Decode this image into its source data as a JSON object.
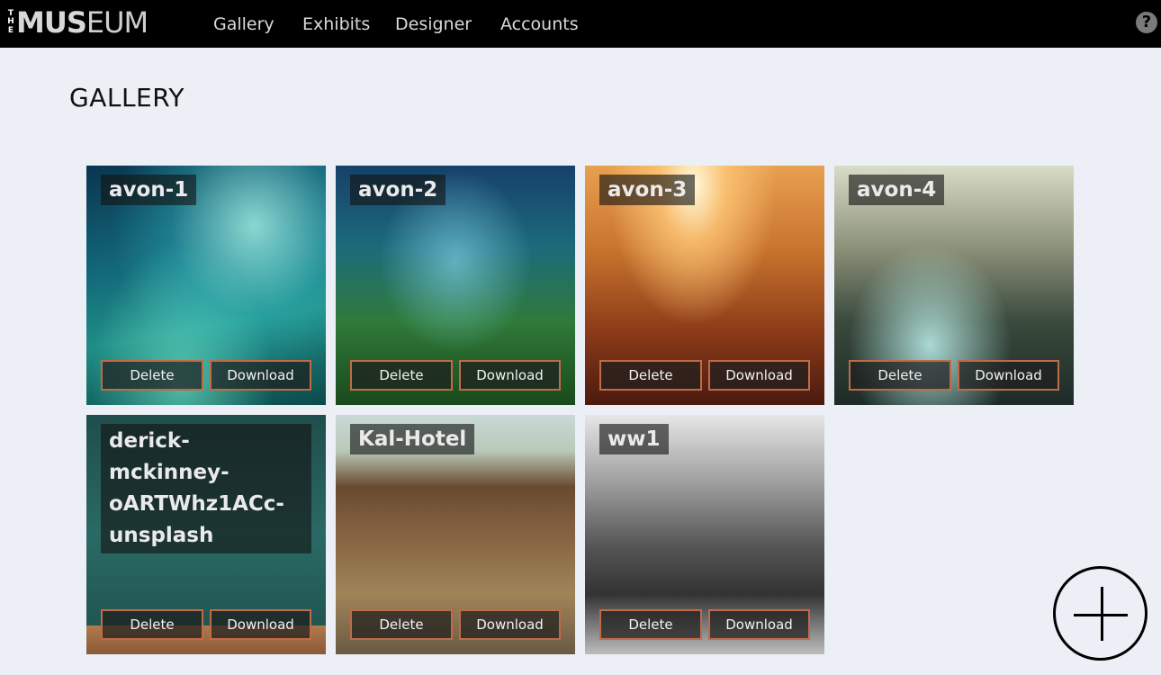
{
  "brand": {
    "logo_small": "THE",
    "logo_bold": "MUS",
    "logo_light": "EUM"
  },
  "nav": [
    "Gallery",
    "Exhibits",
    "Designer",
    "Accounts"
  ],
  "help_icon": "?",
  "page_title": "GALLERY",
  "buttons": {
    "delete": "Delete",
    "download": "Download"
  },
  "items": [
    {
      "name": "avon-1"
    },
    {
      "name": "avon-2"
    },
    {
      "name": "avon-3"
    },
    {
      "name": "avon-4"
    },
    {
      "name": "derick-mckinney-oARTWhz1ACc-unsplash",
      "lines": [
        "derick-",
        "mckinney-",
        "oARTWhz1ACc-",
        "unsplash"
      ]
    },
    {
      "name": "Kal-Hotel"
    },
    {
      "name": "ww1"
    }
  ],
  "colors": {
    "topbar": "#000000",
    "background": "#eceff6",
    "button_border": "#c06b48"
  },
  "icons": {
    "help": "help-icon",
    "add": "plus-icon"
  }
}
